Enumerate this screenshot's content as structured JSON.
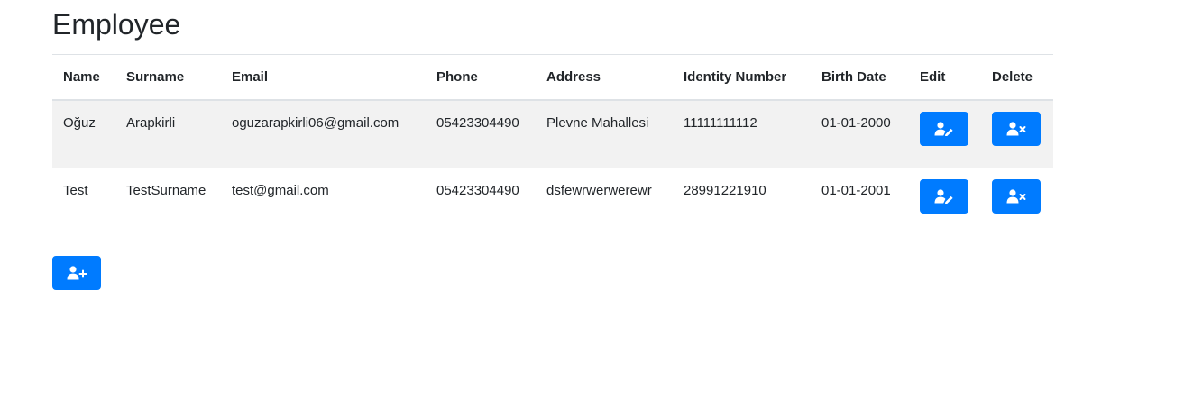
{
  "page": {
    "title": "Employee"
  },
  "table": {
    "headers": {
      "name": "Name",
      "surname": "Surname",
      "email": "Email",
      "phone": "Phone",
      "address": "Address",
      "identity_number": "Identity Number",
      "birth_date": "Birth Date",
      "edit": "Edit",
      "delete": "Delete"
    },
    "rows": [
      {
        "name": "Oğuz",
        "surname": "Arapkirli",
        "email": "oguzarapkirli06@gmail.com",
        "phone": "05423304490",
        "address": "Plevne Mahallesi",
        "identity_number": "11111111112",
        "birth_date": "01-01-2000"
      },
      {
        "name": "Test",
        "surname": "TestSurname",
        "email": "test@gmail.com",
        "phone": "05423304490",
        "address": "dsfewrwerwerewr",
        "identity_number": "28991221910",
        "birth_date": "01-01-2001"
      }
    ],
    "edit_icon": "user-edit-icon",
    "delete_icon": "user-times-icon"
  },
  "add_button": {
    "icon": "user-plus-icon"
  },
  "colors": {
    "primary": "#007bff",
    "stripe": "#f2f2f2",
    "border": "#dee2e6",
    "text": "#212529"
  }
}
